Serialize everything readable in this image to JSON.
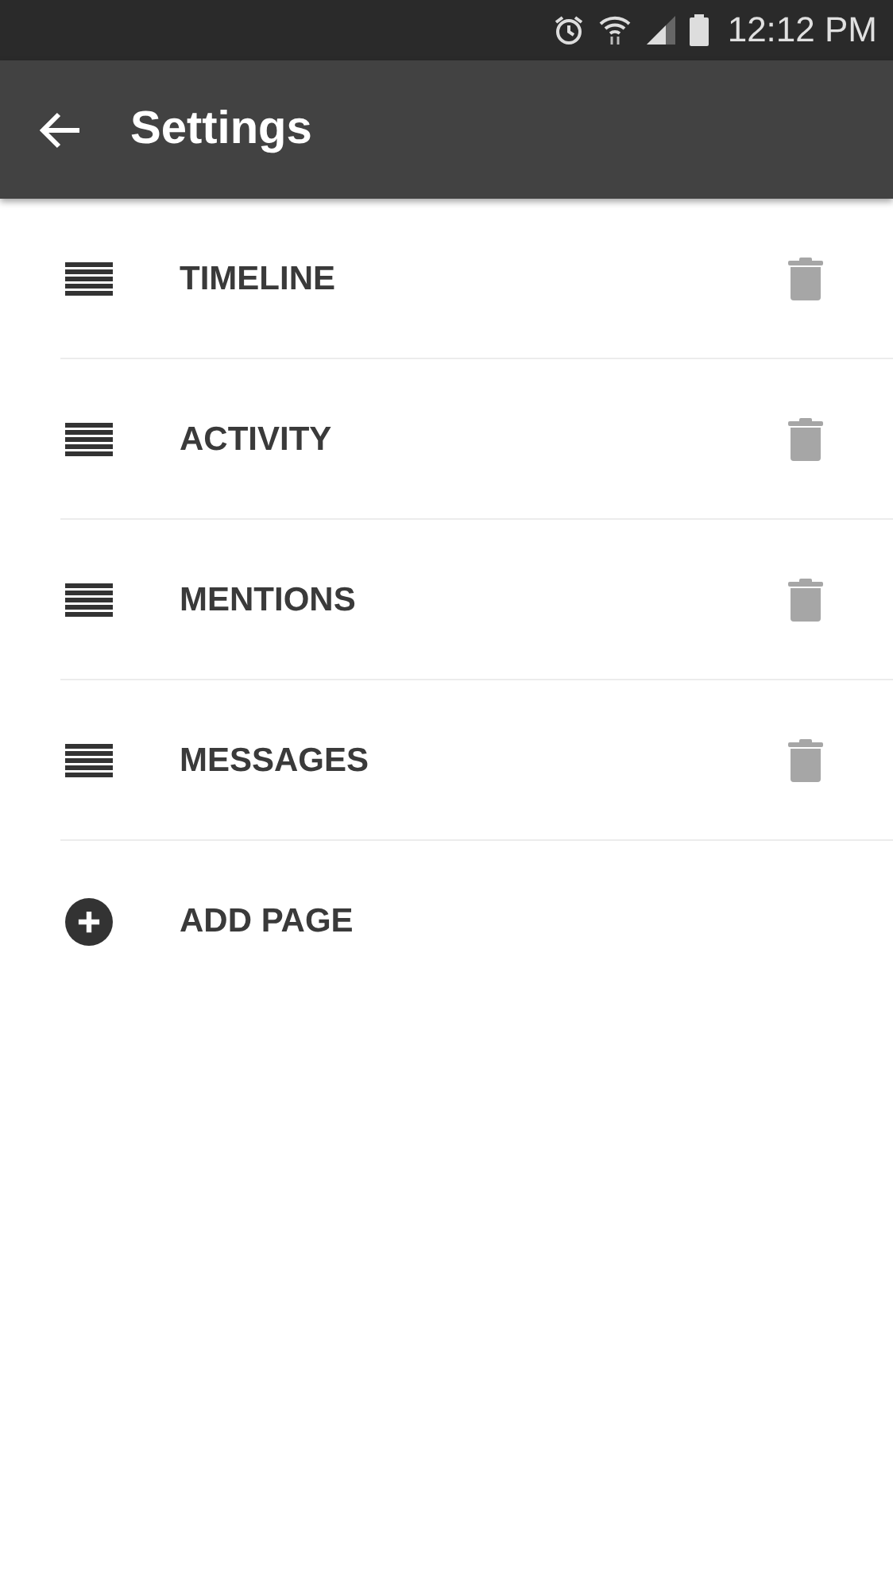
{
  "status_bar": {
    "time": "12:12 PM"
  },
  "app_bar": {
    "title": "Settings"
  },
  "items": [
    {
      "kind": "page",
      "label": "TIMELINE"
    },
    {
      "kind": "page",
      "label": "ACTIVITY"
    },
    {
      "kind": "page",
      "label": "MENTIONS"
    },
    {
      "kind": "page",
      "label": "MESSAGES"
    },
    {
      "kind": "add",
      "label": "ADD PAGE"
    }
  ]
}
